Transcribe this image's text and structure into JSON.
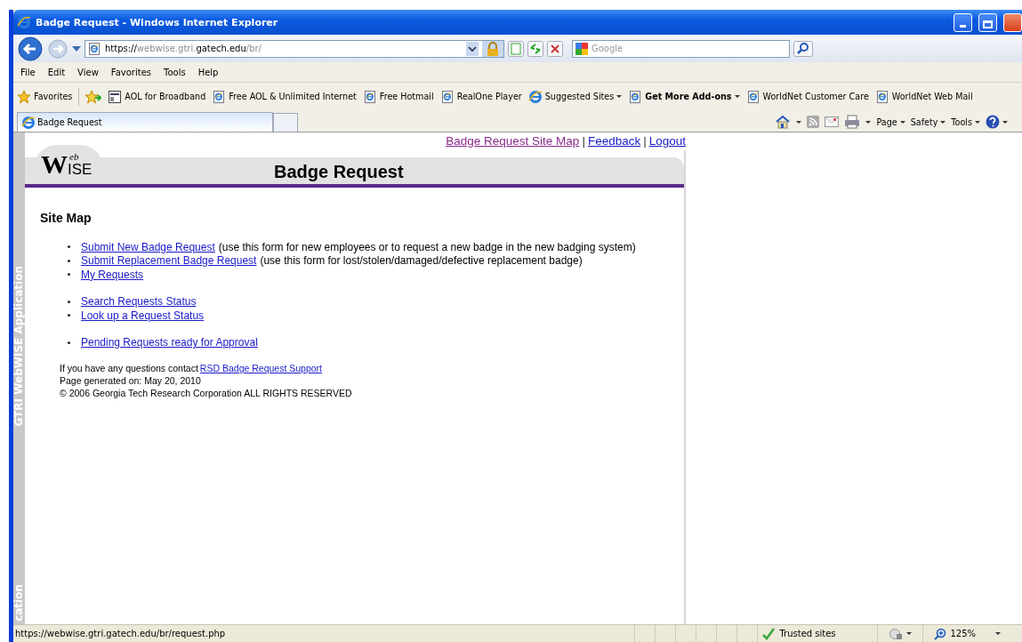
{
  "window": {
    "title": "Badge Request - Windows Internet Explorer"
  },
  "address_bar": {
    "url_parts": [
      {
        "text": "https://",
        "dim": false
      },
      {
        "text": "webwise.gtri.",
        "dim": true
      },
      {
        "text": "gatech.edu",
        "dim": false
      },
      {
        "text": "/br/",
        "dim": true
      }
    ],
    "search_placeholder": "Google"
  },
  "menu": [
    "File",
    "Edit",
    "View",
    "Favorites",
    "Tools",
    "Help"
  ],
  "favorites_bar": {
    "label": "Favorites",
    "items": [
      {
        "label": "AOL for Broadband",
        "kind": "app",
        "bold": false,
        "dropdown": false
      },
      {
        "label": "Free AOL & Unlimited Internet",
        "kind": "page",
        "bold": false,
        "dropdown": false
      },
      {
        "label": "Free Hotmail",
        "kind": "page",
        "bold": false,
        "dropdown": false
      },
      {
        "label": "RealOne Player",
        "kind": "page",
        "bold": false,
        "dropdown": false
      },
      {
        "label": "Suggested Sites",
        "kind": "ie",
        "bold": false,
        "dropdown": true
      },
      {
        "label": "Get More Add-ons",
        "kind": "page",
        "bold": true,
        "dropdown": true
      },
      {
        "label": "WorldNet Customer Care",
        "kind": "page",
        "bold": false,
        "dropdown": false
      },
      {
        "label": "WorldNet Web Mail",
        "kind": "page",
        "bold": false,
        "dropdown": false
      }
    ]
  },
  "tabs": [
    {
      "label": "Badge Request",
      "selected": true
    }
  ],
  "command_bar": [
    "Page",
    "Safety",
    "Tools"
  ],
  "page": {
    "top_links": [
      {
        "label": "Badge Request Site Map",
        "visited": true
      },
      {
        "label": "Feedback",
        "visited": false
      },
      {
        "label": "Logout",
        "visited": false
      }
    ],
    "separator": "|",
    "side_label": "GTRI WebWISE Application",
    "side_label_tail": "cation",
    "logo": {
      "big": "W",
      "small": "eb",
      "rest": "ISE"
    },
    "title": "Badge Request",
    "heading": "Site Map",
    "groups": [
      [
        {
          "link": "Submit New Badge Request ",
          "note": "(use this form for new employees or to request a new badge in the new badging system)"
        },
        {
          "link": "Submit Replacement Badge Request ",
          "note": "(use this form for lost/stolen/damaged/defective replacement badge)"
        },
        {
          "link": "My Requests"
        }
      ],
      [
        {
          "link": "Search Requests Status"
        },
        {
          "link": "Look up a Request Status"
        }
      ],
      [
        {
          "link": "Pending Requests ready for Approval"
        }
      ]
    ],
    "contact_text": "If you have any questions contact",
    "contact_link": "RSD Badge Request Support",
    "generated": "Page generated on: May 20, 2010",
    "copyright": "© 2006 Georgia Tech Research Corporation ALL RIGHTS RESERVED"
  },
  "status_bar": {
    "url": "https://webwise.gtri.gatech.edu/br/request.php",
    "zone": "Trusted sites",
    "zoom": "125%"
  }
}
